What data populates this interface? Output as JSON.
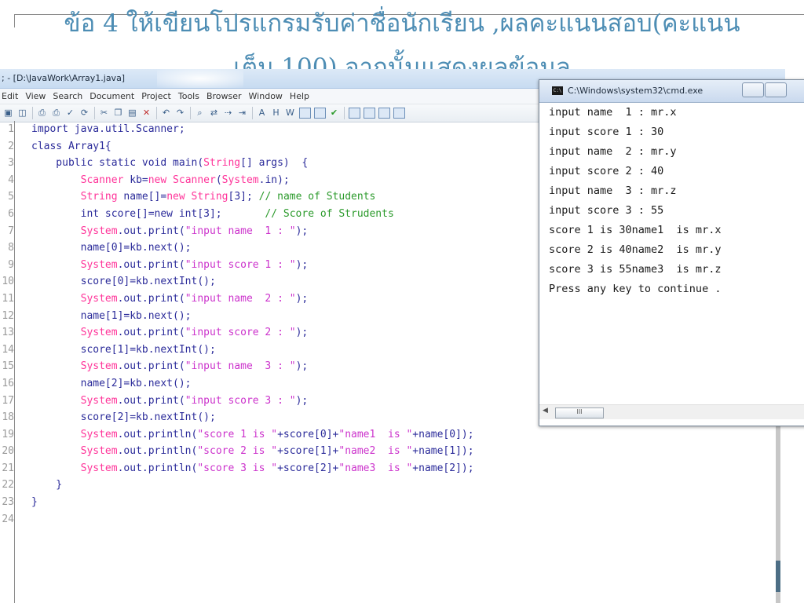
{
  "slide": {
    "title_line1": "ข้อ 4  ให้เขียนโปรแกรมรับค่าชื่อนักเรียน ,ผลคะแนนสอบ(คะแนน",
    "title_line2": "เต็ม 100) จากนั้นแสดงผลข้อมูล"
  },
  "editor": {
    "title": "; - [D:\\JavaWork\\Array1.java]",
    "menu": [
      "Edit",
      "View",
      "Search",
      "Document",
      "Project",
      "Tools",
      "Browser",
      "Window",
      "Help"
    ],
    "code_lines": [
      {
        "n": "1",
        "parts": [
          [
            "kw",
            "import java.util.Scanner;"
          ]
        ]
      },
      {
        "n": "2",
        "parts": [
          [
            "kw",
            "class Array1{"
          ]
        ]
      },
      {
        "n": "3",
        "parts": [
          [
            "kw",
            "    public static void main("
          ],
          [
            "cls",
            "String"
          ],
          [
            "kw",
            "[] args)  {"
          ]
        ]
      },
      {
        "n": "4",
        "parts": [
          [
            "kw",
            "        "
          ],
          [
            "cls",
            "Scanner"
          ],
          [
            "kw",
            " kb="
          ],
          [
            "cls",
            "new Scanner"
          ],
          [
            "kw",
            "("
          ],
          [
            "cls",
            "System"
          ],
          [
            "kw",
            ".in);"
          ]
        ]
      },
      {
        "n": "5",
        "parts": [
          [
            "kw",
            "        "
          ],
          [
            "cls",
            "String"
          ],
          [
            "kw",
            " name[]="
          ],
          [
            "cls",
            "new String"
          ],
          [
            "kw",
            "[3]; "
          ],
          [
            "com",
            "// name of Students"
          ]
        ]
      },
      {
        "n": "6",
        "parts": [
          [
            "kw",
            "        int score[]=new int[3];       "
          ],
          [
            "com",
            "// Score of Strudents"
          ]
        ]
      },
      {
        "n": "7",
        "parts": [
          [
            "kw",
            "        "
          ],
          [
            "cls",
            "System"
          ],
          [
            "kw",
            ".out.print("
          ],
          [
            "str",
            "\"input name  1 : \""
          ],
          [
            "kw",
            ");"
          ]
        ]
      },
      {
        "n": "8",
        "parts": [
          [
            "kw",
            "        name[0]=kb.next();"
          ]
        ]
      },
      {
        "n": "9",
        "parts": [
          [
            "kw",
            "        "
          ],
          [
            "cls",
            "System"
          ],
          [
            "kw",
            ".out.print("
          ],
          [
            "str",
            "\"input score 1 : \""
          ],
          [
            "kw",
            ");"
          ]
        ]
      },
      {
        "n": "10",
        "parts": [
          [
            "kw",
            "        score[0]=kb.nextInt();"
          ]
        ]
      },
      {
        "n": "11",
        "parts": [
          [
            "kw",
            "        "
          ],
          [
            "cls",
            "System"
          ],
          [
            "kw",
            ".out.print("
          ],
          [
            "str",
            "\"input name  2 : \""
          ],
          [
            "kw",
            ");"
          ]
        ]
      },
      {
        "n": "12",
        "parts": [
          [
            "kw",
            "        name[1]=kb.next();"
          ]
        ]
      },
      {
        "n": "13",
        "parts": [
          [
            "kw",
            "        "
          ],
          [
            "cls",
            "System"
          ],
          [
            "kw",
            ".out.print("
          ],
          [
            "str",
            "\"input score 2 : \""
          ],
          [
            "kw",
            ");"
          ]
        ]
      },
      {
        "n": "14",
        "parts": [
          [
            "kw",
            "        score[1]=kb.nextInt();"
          ]
        ]
      },
      {
        "n": "15",
        "parts": [
          [
            "kw",
            "        "
          ],
          [
            "cls",
            "System"
          ],
          [
            "kw",
            ".out.print("
          ],
          [
            "str",
            "\"input name  3 : \""
          ],
          [
            "kw",
            ");"
          ]
        ]
      },
      {
        "n": "16",
        "parts": [
          [
            "kw",
            "        name[2]=kb.next();"
          ]
        ]
      },
      {
        "n": "17",
        "parts": [
          [
            "kw",
            "        "
          ],
          [
            "cls",
            "System"
          ],
          [
            "kw",
            ".out.print("
          ],
          [
            "str",
            "\"input score 3 : \""
          ],
          [
            "kw",
            ");"
          ]
        ]
      },
      {
        "n": "18",
        "parts": [
          [
            "kw",
            "        score[2]=kb.nextInt();"
          ]
        ]
      },
      {
        "n": "19",
        "parts": [
          [
            "kw",
            "        "
          ],
          [
            "cls",
            "System"
          ],
          [
            "kw",
            ".out.println("
          ],
          [
            "str",
            "\"score 1 is \""
          ],
          [
            "kw",
            "+score[0]+"
          ],
          [
            "str",
            "\"name1  is \""
          ],
          [
            "kw",
            "+name[0]);"
          ]
        ]
      },
      {
        "n": "20",
        "parts": [
          [
            "kw",
            "        "
          ],
          [
            "cls",
            "System"
          ],
          [
            "kw",
            ".out.println("
          ],
          [
            "str",
            "\"score 2 is \""
          ],
          [
            "kw",
            "+score[1]+"
          ],
          [
            "str",
            "\"name2  is \""
          ],
          [
            "kw",
            "+name[1]);"
          ]
        ]
      },
      {
        "n": "21",
        "parts": [
          [
            "kw",
            "        "
          ],
          [
            "cls",
            "System"
          ],
          [
            "kw",
            ".out.println("
          ],
          [
            "str",
            "\"score 3 is \""
          ],
          [
            "kw",
            "+score[2]+"
          ],
          [
            "str",
            "\"name3  is \""
          ],
          [
            "kw",
            "+name[2]);"
          ]
        ]
      },
      {
        "n": "22",
        "parts": [
          [
            "kw",
            "    }"
          ]
        ]
      },
      {
        "n": "23",
        "parts": [
          [
            "kw",
            "}"
          ]
        ]
      },
      {
        "n": "24",
        "parts": []
      }
    ]
  },
  "cmd": {
    "title": "C:\\Windows\\system32\\cmd.exe",
    "icon_text": "C:\\",
    "lines": [
      "input name  1 : mr.x",
      "input score 1 : 30",
      "input name  2 : mr.y",
      "input score 2 : 40",
      "input name  3 : mr.z",
      "input score 3 : 55",
      "score 1 is 30name1  is mr.x",
      "score 2 is 40name2  is mr.y",
      "score 3 is 55name3  is mr.z",
      "Press any key to continue ."
    ],
    "hscroll_thumb": "III"
  }
}
